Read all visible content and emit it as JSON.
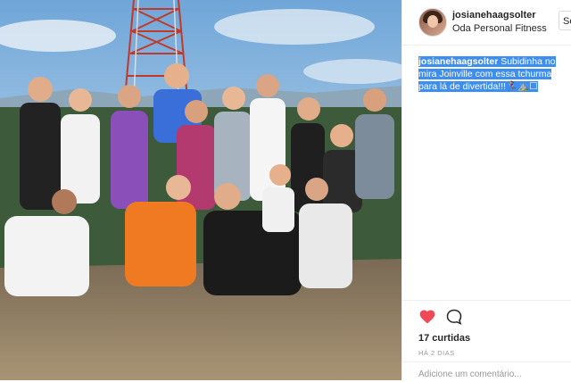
{
  "post": {
    "username": "josianehaagsolter",
    "subtitle": "Oda Personal Fitness",
    "follow_label": "Se",
    "caption_user": "josianehaagsolter",
    "caption_text": " Subidinha no mira Joinville com essa tchurma para lá de divertida!!!🏃‍♀️⛰️☐",
    "likes": "17 curtidas",
    "timestamp": "HÁ 2 DIAS",
    "add_comment_placeholder": "Adicione um comentário..."
  },
  "colors": {
    "highlight": "#3d8ef0",
    "like": "#ed4956"
  },
  "icons": {
    "like": "heart-icon",
    "comment": "comment-icon"
  }
}
